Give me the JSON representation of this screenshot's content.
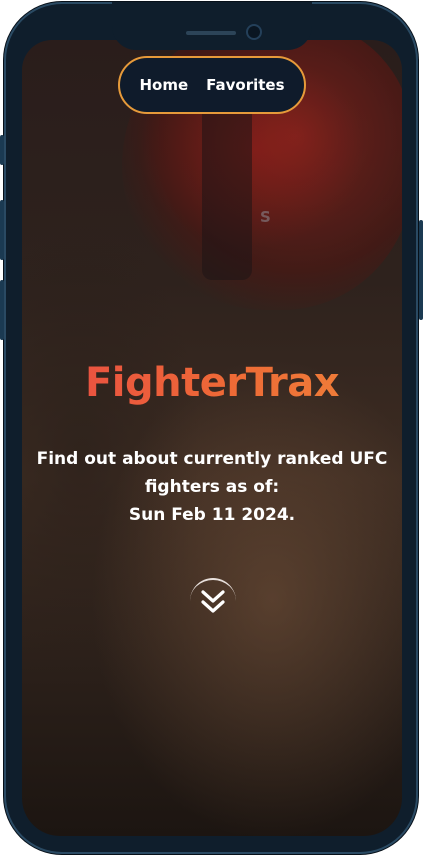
{
  "nav": {
    "home_label": "Home",
    "favorites_label": "Favorites"
  },
  "hero": {
    "title": "FighterTrax",
    "subtitle_line1": "Find out about currently ranked UFC",
    "subtitle_line2": "fighters as of:",
    "date": "Sun Feb 11 2024.",
    "scroll_icon": "double-chevron-down-icon"
  },
  "colors": {
    "accent_border": "#e69a3a",
    "title_gradient_start": "#e84a44",
    "title_gradient_end": "#f0853a",
    "nav_bg": "#0f1b2b",
    "frame": "#0f1e2c"
  }
}
